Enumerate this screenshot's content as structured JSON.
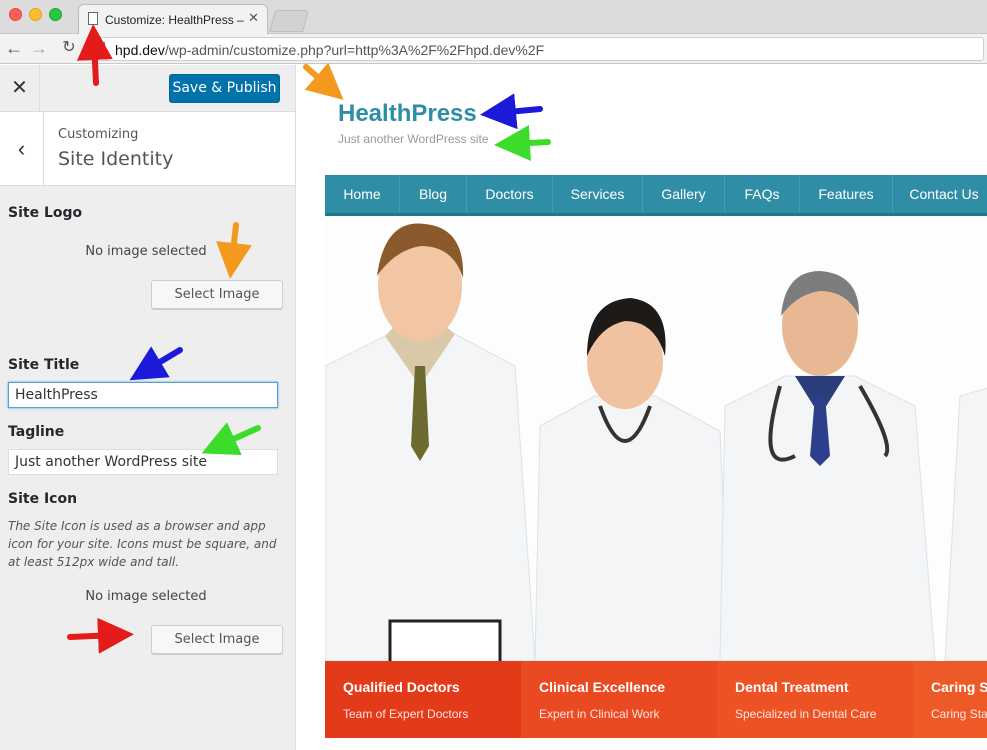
{
  "browser": {
    "tab_title": "Customize: HealthPress – J",
    "url_host": "hpd.dev",
    "url_path": "/wp-admin/customize.php?url=http%3A%2F%2Fhpd.dev%2F"
  },
  "customizer": {
    "save_label": "Save & Publish",
    "breadcrumb_small": "Customizing",
    "section_title": "Site Identity",
    "logo_label": "Site Logo",
    "logo_status": "No image selected",
    "logo_button": "Select Image",
    "title_label": "Site Title",
    "title_value": "HealthPress",
    "tagline_label": "Tagline",
    "tagline_value": "Just another WordPress site",
    "icon_label": "Site Icon",
    "icon_description": "The Site Icon is used as a browser and app icon for your site. Icons must be square, and at least 512px wide and tall.",
    "icon_status": "No image selected",
    "icon_button": "Select Image"
  },
  "preview": {
    "site_title": "HealthPress",
    "tagline": "Just another WordPress site",
    "nav": [
      "Home",
      "Blog",
      "Doctors",
      "Services",
      "Gallery",
      "FAQs",
      "Features",
      "Contact Us"
    ],
    "features": [
      {
        "title": "Qualified Doctors",
        "subtitle": "Team of Expert Doctors"
      },
      {
        "title": "Clinical Excellence",
        "subtitle": "Expert in Clinical Work"
      },
      {
        "title": "Dental Treatment",
        "subtitle": "Specialized in Dental Care"
      },
      {
        "title": "Caring S",
        "subtitle": "Caring Sta"
      }
    ]
  },
  "colors": {
    "accent": "#2f8ea5",
    "wp_blue": "#0073aa",
    "feature_bg": "#e8411f"
  }
}
